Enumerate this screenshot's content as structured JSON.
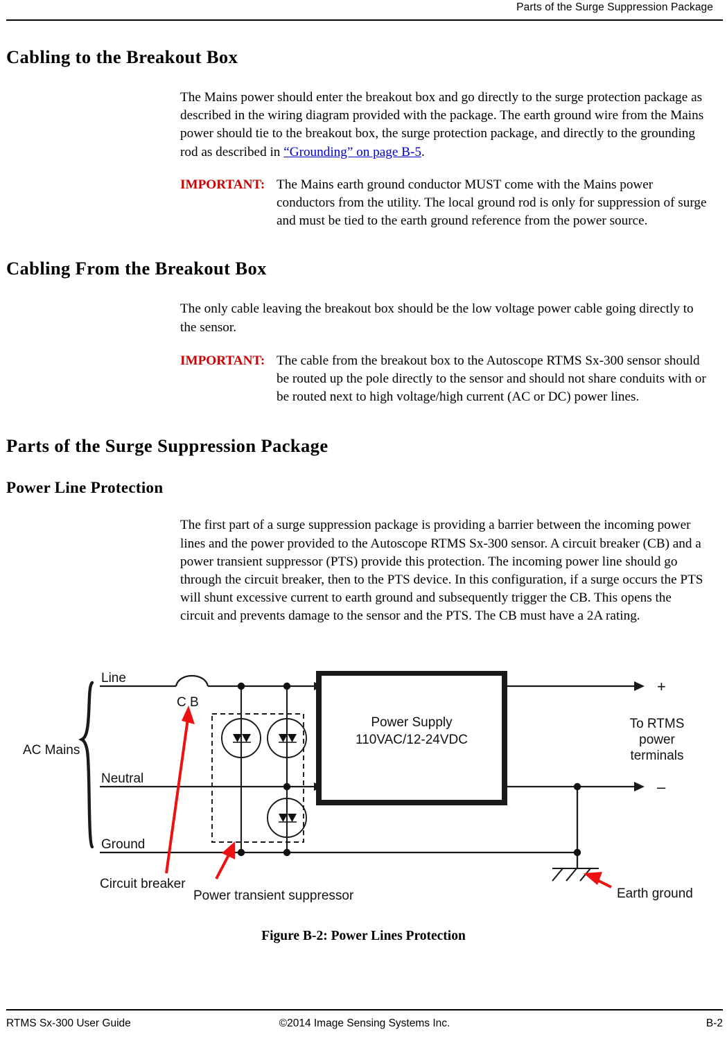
{
  "header": {
    "running_head": "Parts of the Surge Suppression Package"
  },
  "sections": {
    "cabling_to": {
      "heading": "Cabling to the Breakout Box",
      "paragraph": "The Mains power should enter the breakout box and go directly to the surge protection package as described in the wiring diagram provided with the package. The earth ground wire from the Mains power should tie to the breakout box, the surge protection package, and directly to the grounding rod as described in ",
      "link_text": "“Grounding” on page B-5",
      "paragraph_tail": ".",
      "important_label": "IMPORTANT:",
      "important_text": "The Mains earth ground conductor MUST come with the Mains power conductors from the utility. The local ground rod is only for suppression of surge and must be tied to the earth ground reference from the power source."
    },
    "cabling_from": {
      "heading": "Cabling From the Breakout Box",
      "paragraph": "The only cable leaving the breakout box should be the low voltage power cable going directly to the sensor.",
      "important_label": "IMPORTANT:",
      "important_text": "The cable from the breakout box to the Autoscope RTMS Sx-300 sensor should be routed up the pole directly to the sensor and should not share conduits with or be routed next to high voltage/high current (AC or DC) power lines."
    },
    "parts": {
      "heading": "Parts of the Surge Suppression Package"
    },
    "power_line_protection": {
      "heading": "Power Line Protection",
      "paragraph": "The first part of a surge suppression package is providing a barrier between the incoming power lines and the power provided to the Autoscope RTMS Sx-300 sensor. A circuit breaker (CB) and a power transient suppressor (PTS) provide this protection. The incoming power line should go through the circuit breaker, then to the PTS device. In this configuration, if a surge occurs the PTS will shunt excessive current to earth ground and subsequently trigger the CB. This opens the circuit and prevents damage to the sensor and the PTS. The CB must have a 2A rating."
    }
  },
  "figure": {
    "caption": "Figure B-2: Power Lines Protection",
    "labels": {
      "ac_mains": "AC Mains",
      "line": "Line",
      "neutral": "Neutral",
      "ground": "Ground",
      "cb": "C B",
      "circuit_breaker": "Circuit breaker",
      "power_transient_suppressor": "Power transient suppressor",
      "power_supply_line1": "Power Supply",
      "power_supply_line2": "110VAC/12-24VDC",
      "plus": "+",
      "minus": "–",
      "to_rtms_line1": "To RTMS",
      "to_rtms_line2": "power",
      "to_rtms_line3": "terminals",
      "earth_ground": "Earth ground"
    },
    "colors": {
      "annotation_arrow": "#ee1111",
      "wire": "#1a1a1a",
      "box_border": "#1a1a1a"
    }
  },
  "footer": {
    "left": "RTMS Sx-300 User Guide",
    "center": "©2014 Image Sensing Systems Inc.",
    "right": "B-2"
  }
}
